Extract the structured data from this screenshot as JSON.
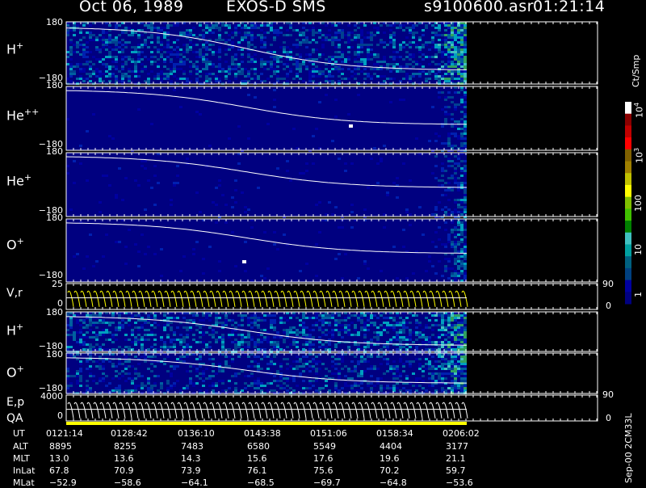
{
  "header": {
    "date": "Oct 06, 1989",
    "mission": "EXOS-D SMS",
    "file": "s9100600.asr",
    "time": "01:21:14"
  },
  "chart_data": [
    {
      "type": "heatmap",
      "panel": "H+",
      "label_main": "H",
      "label_sup": "+",
      "ylim": [
        -180,
        180
      ],
      "y_ticks": [
        "180",
        "−180"
      ]
    },
    {
      "type": "heatmap",
      "panel": "He++",
      "label_main": "He",
      "label_sup": "++",
      "ylim": [
        -180,
        180
      ],
      "y_ticks": [
        "180",
        "−180"
      ]
    },
    {
      "type": "heatmap",
      "panel": "He+",
      "label_main": "He",
      "label_sup": "+",
      "ylim": [
        -180,
        180
      ],
      "y_ticks": [
        "180",
        "−180"
      ]
    },
    {
      "type": "heatmap",
      "panel": "O+",
      "label_main": "O",
      "label_sup": "+",
      "ylim": [
        -180,
        180
      ],
      "y_ticks": [
        "180",
        "−180"
      ]
    },
    {
      "type": "line",
      "panel": "V,r",
      "label_main": "V,r",
      "label_sup": "",
      "left_ticks": [
        "25",
        "0"
      ],
      "right_ticks": [
        "90",
        "0"
      ]
    },
    {
      "type": "heatmap",
      "panel": "H+ (2)",
      "label_main": "H",
      "label_sup": "+",
      "ylim": [
        -180,
        180
      ],
      "y_ticks": [
        "180",
        "−180"
      ]
    },
    {
      "type": "heatmap",
      "panel": "O+ (2)",
      "label_main": "O",
      "label_sup": "+",
      "ylim": [
        -180,
        180
      ],
      "y_ticks": [
        "180",
        "−180"
      ]
    },
    {
      "type": "line",
      "panel": "E,p",
      "label_main": "E,p",
      "label_sup": "",
      "left_ticks": [
        "4000",
        "0"
      ],
      "right_ticks": [
        "90",
        "0"
      ]
    }
  ],
  "qa_label": "QA",
  "colorbar": {
    "unit": "Ct/Smp",
    "tick_labels": [
      "10",
      "10",
      "100",
      "10",
      "1"
    ],
    "tick_exponents": [
      "4",
      "3",
      "",
      "",
      ""
    ],
    "colors": [
      "#ffffff",
      "#8b0000",
      "#c00000",
      "#ff0000",
      "#806000",
      "#a08000",
      "#c0c000",
      "#ffff00",
      "#80c000",
      "#40c000",
      "#008000",
      "#40c0c0",
      "#00a0a0",
      "#006080",
      "#004080",
      "#0000a0",
      "#000080"
    ]
  },
  "footer_note": "Sep-00 2CM33L",
  "ephemeris": {
    "row_labels": [
      "UT",
      "ALT",
      "MLT",
      "InLat",
      "MLat"
    ],
    "columns": [
      [
        "0121:14",
        "8895",
        "13.0",
        "67.8",
        "−52.9"
      ],
      [
        "0128:42",
        "8255",
        "13.6",
        "70.9",
        "−58.6"
      ],
      [
        "0136:10",
        "7483",
        "14.3",
        "73.9",
        "−64.1"
      ],
      [
        "0143:38",
        "6580",
        "15.6",
        "76.1",
        "−68.5"
      ],
      [
        "0151:06",
        "5549",
        "17.6",
        "75.6",
        "−69.7"
      ],
      [
        "0158:34",
        "4404",
        "19.6",
        "70.2",
        "−64.8"
      ],
      [
        "0206:02",
        "3177",
        "21.1",
        "59.7",
        "−53.6"
      ]
    ]
  }
}
